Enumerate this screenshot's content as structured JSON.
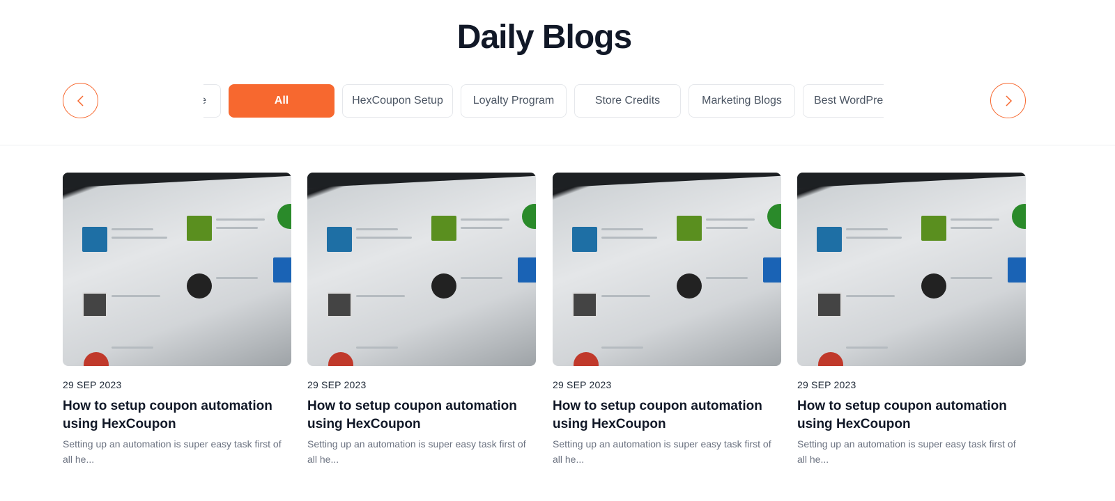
{
  "header": {
    "title": "Daily Blogs"
  },
  "nav": {
    "prev_icon": "chevron-left-icon",
    "next_icon": "chevron-right-icon"
  },
  "filters": {
    "active": "All",
    "items": [
      {
        "label": "e"
      },
      {
        "label": "All"
      },
      {
        "label": "HexCoupon Setup"
      },
      {
        "label": "Loyalty Program"
      },
      {
        "label": "Store Credits"
      },
      {
        "label": "Marketing Blogs"
      },
      {
        "label": "Best WordPress"
      }
    ]
  },
  "colors": {
    "accent": "#f7682f"
  },
  "posts": [
    {
      "date": "29 SEP 2023",
      "title": "How to setup coupon automation using HexCoupon",
      "excerpt": "Setting up an automation is super easy task first of all he..."
    },
    {
      "date": "29 SEP 2023",
      "title": "How to setup coupon automation using HexCoupon",
      "excerpt": "Setting up an automation is super easy task first of all he..."
    },
    {
      "date": "29 SEP 2023",
      "title": "How to setup coupon automation using HexCoupon",
      "excerpt": "Setting up an automation is super easy task first of all he..."
    },
    {
      "date": "29 SEP 2023",
      "title": "How to setup coupon automation using HexCoupon",
      "excerpt": "Setting up an automation is super easy task first of all he..."
    }
  ]
}
